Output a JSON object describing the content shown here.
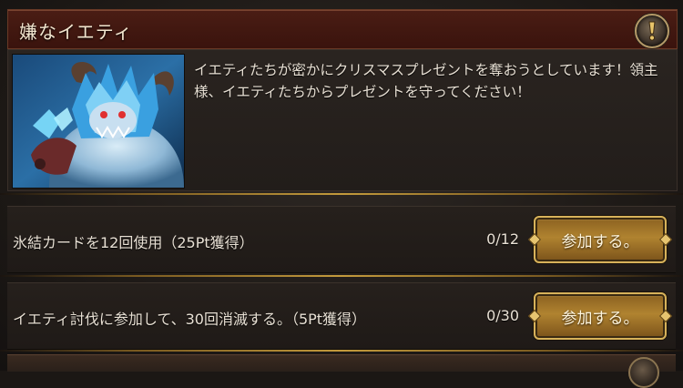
{
  "event": {
    "title": "嫌なイエティ",
    "description": "イエティたちが密かにクリスマスプレゼントを奪おうとしています！領主様、イエティたちからプレゼントを守ってください！",
    "image_icon": "yeti-monster",
    "info_icon": "exclamation-icon"
  },
  "quests": [
    {
      "text": "氷結カードを12回使用（25Pt獲得）",
      "progress": "0/12",
      "button_label": "参加する。"
    },
    {
      "text": "イエティ討伐に参加して、30回消滅する。（5Pt獲得）",
      "progress": "0/30",
      "button_label": "参加する。"
    }
  ],
  "colors": {
    "header": "#4a1d14",
    "button_gold": "#b08330",
    "text": "#e8e0d4"
  }
}
